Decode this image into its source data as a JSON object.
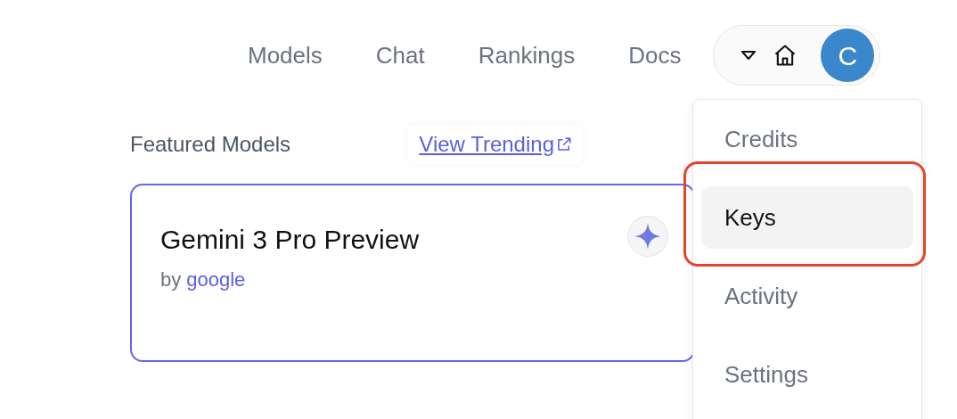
{
  "nav": {
    "links": [
      "Models",
      "Chat",
      "Rankings",
      "Docs"
    ],
    "avatar": "C"
  },
  "account_menu": {
    "items": [
      {
        "label": "Credits",
        "selected": false
      },
      {
        "label": "Keys",
        "selected": true,
        "highlighted": true
      },
      {
        "label": "Activity",
        "selected": false
      },
      {
        "label": "Settings",
        "selected": false
      }
    ]
  },
  "featured": {
    "title": "Featured Models",
    "link": "View Trending",
    "card": {
      "name": "Gemini 3 Pro Preview",
      "by": "by",
      "author": "google"
    }
  }
}
